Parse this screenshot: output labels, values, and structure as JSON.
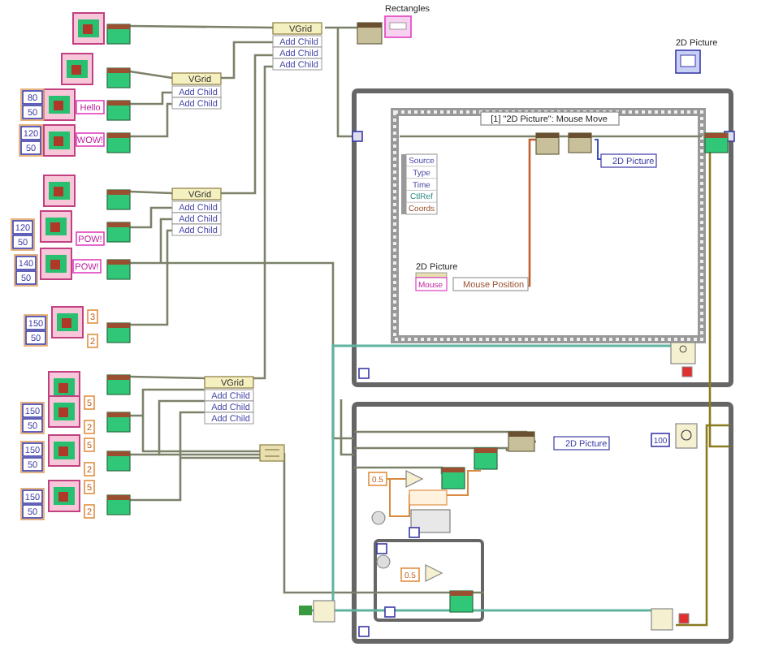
{
  "constructors": [
    {
      "kind": "class"
    },
    {
      "kind": "class"
    },
    {
      "kind": "class",
      "cluster": [
        "80",
        "50"
      ],
      "string": "Hello"
    },
    {
      "kind": "class",
      "cluster": [
        "120",
        "50"
      ],
      "string": "WOW!"
    },
    {
      "kind": "class"
    },
    {
      "kind": "class",
      "cluster": [
        "120",
        "50"
      ],
      "string": "POW!"
    },
    {
      "kind": "class",
      "cluster": [
        "140",
        "50"
      ],
      "string": "POW!"
    },
    {
      "kind": "class",
      "cluster": [
        "150",
        "50"
      ],
      "consts": [
        "3",
        "2"
      ]
    },
    {
      "kind": "class"
    },
    {
      "kind": "class",
      "cluster": [
        "150",
        "50"
      ],
      "consts": [
        "5",
        "2"
      ]
    },
    {
      "kind": "class",
      "cluster": [
        "150",
        "50"
      ],
      "consts": [
        "5",
        "2"
      ]
    },
    {
      "kind": "class",
      "cluster": [
        "150",
        "50"
      ],
      "consts": [
        "5",
        "2"
      ]
    }
  ],
  "vgrids": [
    {
      "title": "VGrid",
      "children": [
        "Add Child",
        "Add Child",
        "Add Child"
      ]
    },
    {
      "title": "VGrid",
      "children": [
        "Add Child",
        "Add Child"
      ]
    },
    {
      "title": "VGrid",
      "children": [
        "Add Child",
        "Add Child",
        "Add Child"
      ]
    },
    {
      "title": "VGrid",
      "children": [
        "Add Child",
        "Add Child",
        "Add Child"
      ]
    }
  ],
  "rectangles_label": "Rectangles",
  "picture_control_label": "2D Picture",
  "event_loop": {
    "event_header": "[1] \"2D Picture\": Mouse Move",
    "event_data": [
      "Source",
      "Type",
      "Time",
      "CtlRef",
      "Coords"
    ],
    "property_label": "2D Picture",
    "property_class": "Mouse",
    "property_item": "Mouse Position",
    "local_label": "2D Picture"
  },
  "draw_loop": {
    "local_label": "2D Picture",
    "wait_ms": "100",
    "consts": [
      "0.5",
      "0.5"
    ]
  }
}
